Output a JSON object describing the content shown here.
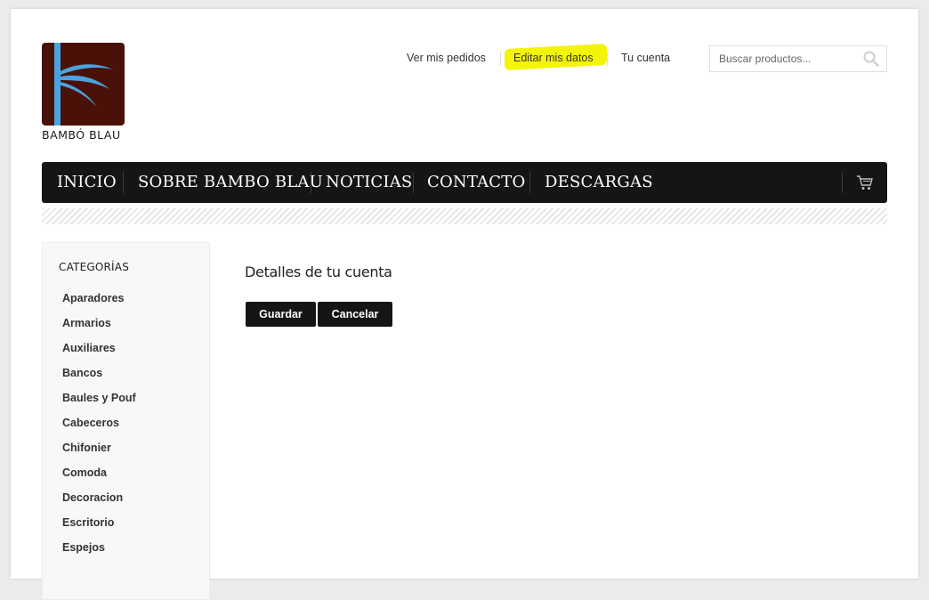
{
  "brand": {
    "name": "BAMBÓ BLAU"
  },
  "top_links": [
    {
      "label": "Ver mis pedidos"
    },
    {
      "label": "Editar mis datos",
      "highlighted": true
    },
    {
      "label": "Tu cuenta"
    }
  ],
  "search": {
    "placeholder": "Buscar productos..."
  },
  "nav": {
    "items": [
      {
        "label": "INICIO"
      },
      {
        "label": "SOBRE BAMBO BLAU"
      },
      {
        "label": "NOTICIAS"
      },
      {
        "label": "CONTACTO"
      },
      {
        "label": "DESCARGAS"
      }
    ],
    "cart_icon": "cart-icon"
  },
  "sidebar": {
    "title": "CATEGORÍAS",
    "categories": [
      "Aparadores",
      "Armarios",
      "Auxiliares",
      "Bancos",
      "Baules y Pouf",
      "Cabeceros",
      "Chifonier",
      "Comoda",
      "Decoracion",
      "Escritorio",
      "Espejos"
    ]
  },
  "main": {
    "title": "Detalles de tu cuenta",
    "save_label": "Guardar",
    "cancel_label": "Cancelar"
  },
  "colors": {
    "nav_bg": "#151515",
    "logo_bg": "#4a1109",
    "logo_accent": "#4aa3df",
    "highlight": "#f4f40a"
  }
}
